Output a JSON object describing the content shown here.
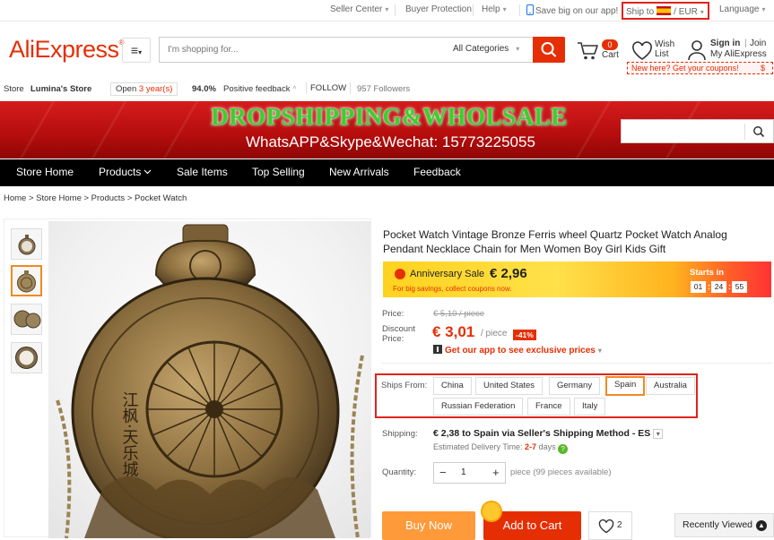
{
  "topbar": {
    "seller_center": "Seller Center",
    "buyer_protection": "Buyer Protection",
    "help": "Help",
    "app_promo": "Save big on our app!",
    "ship_to_label": "Ship to",
    "currency": "EUR",
    "currency_sep": "/",
    "language": "Language"
  },
  "header": {
    "logo": "AliExpress",
    "logo_mark": "®",
    "search_placeholder": "I'm shopping for...",
    "all_categories": "All Categories",
    "cart_count": "0",
    "cart_label": "Cart",
    "wish_list_label": "Wish List",
    "sign_in": "Sign in",
    "join": "Join",
    "my_aliexpress": "My AliExpress",
    "new_here": "New here? Get your coupons!",
    "new_here_symbol": "$"
  },
  "store": {
    "label": "Store",
    "name": "Lumina's Store",
    "open_prefix": "Open",
    "open_years": "3 year(s)",
    "feedback_pct": "94.0%",
    "feedback_label": "Positive feedback",
    "follow": "FOLLOW",
    "followers": "957 Followers"
  },
  "banner": {
    "title": "DROPSHIPPING&WHOLSALE",
    "subtitle": "WhatsAPP&Skype&Wechat: 15773225055"
  },
  "nav": {
    "items": [
      "Store Home",
      "Products",
      "Sale Items",
      "Top Selling",
      "New Arrivals",
      "Feedback"
    ]
  },
  "breadcrumb": "Home > Store Home > Products > Pocket Watch",
  "product": {
    "title": "Pocket Watch Vintage Bronze Ferris wheel Quartz Pocket Watch Analog Pendant Necklace Chain for Men Women Boy Girl Kids Gift",
    "watch_engraving": "江枫·天乐城",
    "sale": {
      "name": "Anniversary Sale",
      "price": "€ 2,96",
      "subtitle": "For big savings, collect coupons now.",
      "starts_in": "Starts in",
      "timer": [
        "01",
        "24",
        "55"
      ],
      "timer_sep": ":"
    },
    "price_label": "Price:",
    "old_price": "€ 5,10 / piece",
    "discount_label_1": "Discount",
    "discount_label_2": "Price:",
    "price": "€ 3,01",
    "per_piece": "/ piece",
    "discount_badge": "-41%",
    "app_line": "Get our app to see exclusive prices",
    "ships_from_label": "Ships From:",
    "ships_from": [
      "China",
      "United States",
      "Germany",
      "Spain",
      "Australia",
      "Russian Federation",
      "France",
      "Italy"
    ],
    "ships_from_selected": "Spain",
    "shipping_label": "Shipping:",
    "shipping": "€ 2,38 to Spain via Seller's Shipping Method - ES",
    "est_prefix": "Estimated Delivery Time:",
    "est_days": "2-7",
    "est_suffix": "days",
    "quantity_label": "Quantity:",
    "quantity_minus": "−",
    "quantity": "1",
    "quantity_plus": "+",
    "quantity_avail": "piece (99 pieces available)",
    "buy_now": "Buy Now",
    "add_to_cart": "Add to Cart",
    "wish_count": "2"
  },
  "recently_viewed": "Recently Viewed",
  "colors": {
    "brand": "#e62e04",
    "buy_now": "#ff9a3b",
    "highlight_box": "#e2231a",
    "selected_chip": "#f08a24"
  }
}
